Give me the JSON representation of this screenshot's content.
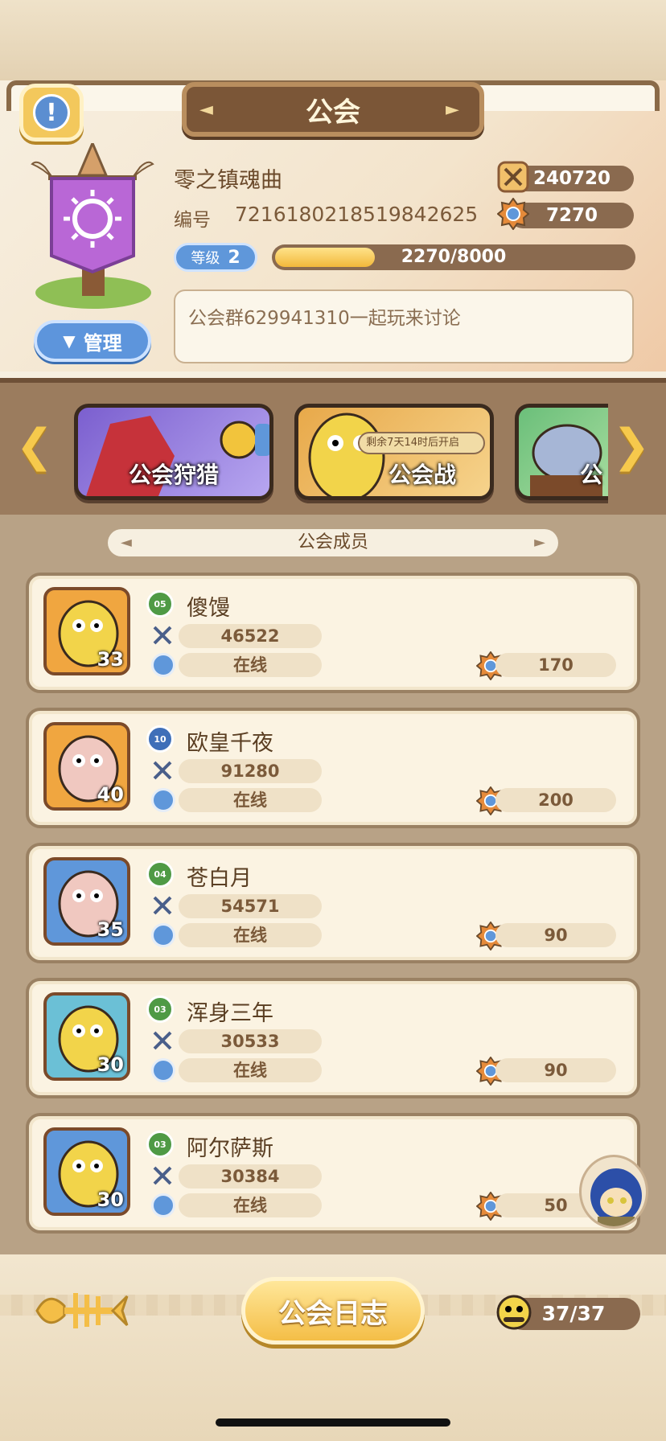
{
  "title": "公会",
  "guild": {
    "name": "零之镇魂曲",
    "id_label": "编号",
    "id": "7216180218519842625",
    "power": "240720",
    "contribution": "7270",
    "level_label": "等级",
    "level": "2",
    "xp_text": "2270/8000",
    "xp_fraction": 0.28,
    "notice": "公会群629941310一起玩来讨论"
  },
  "manage_label": "管理",
  "activities": [
    {
      "label": "公会狩猎",
      "countdown": ""
    },
    {
      "label": "公会战",
      "countdown": "剩余7天14时后开启"
    },
    {
      "label": "公",
      "countdown": ""
    }
  ],
  "members_title": "公会成员",
  "members": [
    {
      "name": "傻馒",
      "rank": "05",
      "power": "46522",
      "status": "在线",
      "contribution": "170",
      "level": "33"
    },
    {
      "name": "欧皇千夜",
      "rank": "10",
      "power": "91280",
      "status": "在线",
      "contribution": "200",
      "level": "40"
    },
    {
      "name": "苍白月",
      "rank": "04",
      "power": "54571",
      "status": "在线",
      "contribution": "90",
      "level": "35"
    },
    {
      "name": "浑身三年",
      "rank": "03",
      "power": "30533",
      "status": "在线",
      "contribution": "90",
      "level": "30"
    },
    {
      "name": "阿尔萨斯",
      "rank": "03",
      "power": "30384",
      "status": "在线",
      "contribution": "50",
      "level": "30"
    }
  ],
  "footer": {
    "log_label": "公会日志",
    "member_count": "37/37"
  },
  "colors": {
    "accent_gold": "#f4be47",
    "accent_blue": "#5f97da",
    "bar_brown": "#8a6a4f",
    "rank_green": "#4f9a45",
    "rank_blue": "#3f6fb8"
  }
}
